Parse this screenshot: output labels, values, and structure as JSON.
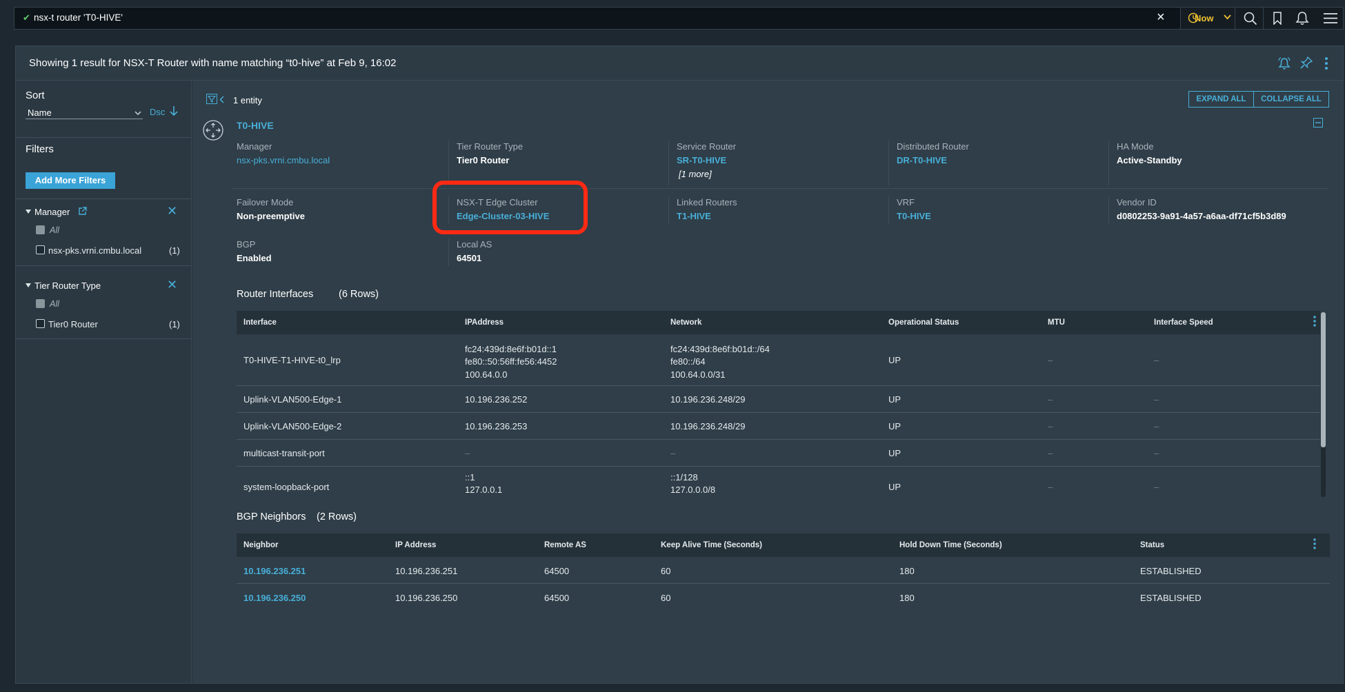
{
  "search": {
    "query": "nsx-t router 'T0-HIVE'",
    "time_label": "Now",
    "icons": [
      "check-icon",
      "close-icon",
      "clock-icon",
      "chevron-down-icon",
      "search-icon",
      "bookmark-icon",
      "bell-icon",
      "menu-icon"
    ]
  },
  "header": {
    "result_text": "Showing 1 result for NSX-T Router with name matching “t0-hive” at Feb 9, 16:02"
  },
  "sidebar": {
    "sort_title": "Sort",
    "sort_value": "Name",
    "sort_dir": "Dsc",
    "filters_title": "Filters",
    "add_filters_label": "Add More Filters",
    "groups": [
      {
        "title": "Manager",
        "all_label": "All",
        "items": [
          {
            "label": "nsx-pks.vrni.cmbu.local",
            "count": "(1)"
          }
        ]
      },
      {
        "title": "Tier Router Type",
        "all_label": "All",
        "items": [
          {
            "label": "Tier0 Router",
            "count": "(1)"
          }
        ]
      }
    ]
  },
  "content": {
    "entity_count": "1 entity",
    "expand_all": "EXPAND ALL",
    "collapse_all": "COLLAPSE ALL",
    "entity_name": "T0-HIVE",
    "properties": {
      "manager": {
        "label": "Manager",
        "value": "nsx-pks.vrni.cmbu.local"
      },
      "tier_router_type": {
        "label": "Tier Router Type",
        "value": "Tier0 Router"
      },
      "service_router": {
        "label": "Service Router",
        "value": "SR-T0-HIVE",
        "more": "[1 more]"
      },
      "distributed_router": {
        "label": "Distributed Router",
        "value": "DR-T0-HIVE"
      },
      "ha_mode": {
        "label": "HA Mode",
        "value": "Active-Standby"
      },
      "failover_mode": {
        "label": "Failover Mode",
        "value": "Non-preemptive"
      },
      "edge_cluster": {
        "label": "NSX-T Edge Cluster",
        "value": "Edge-Cluster-03-HIVE"
      },
      "linked_routers": {
        "label": "Linked Routers",
        "value": "T1-HIVE"
      },
      "vrf": {
        "label": "VRF",
        "value": "T0-HIVE"
      },
      "vendor_id": {
        "label": "Vendor ID",
        "value": "d0802253-9a91-4a57-a6aa-df71cf5b3d89"
      },
      "bgp": {
        "label": "BGP",
        "value": "Enabled"
      },
      "local_as": {
        "label": "Local AS",
        "value": "64501"
      }
    },
    "router_interfaces": {
      "title": "Router Interfaces",
      "count": "(6 Rows)",
      "columns": [
        "Interface",
        "IPAddress",
        "Network",
        "Operational Status",
        "MTU",
        "Interface Speed"
      ],
      "rows": [
        {
          "interface": "T0-HIVE-T1-HIVE-t0_lrp",
          "ip": [
            "fc24:439d:8e6f:b01d::1",
            "fe80::50:56ff:fe56:4452",
            "100.64.0.0"
          ],
          "network": [
            "fc24:439d:8e6f:b01d::/64",
            "fe80::/64",
            "100.64.0.0/31"
          ],
          "status": "UP",
          "mtu": "–",
          "speed": "–"
        },
        {
          "interface": "Uplink-VLAN500-Edge-1",
          "ip": [
            "10.196.236.252"
          ],
          "network": [
            "10.196.236.248/29"
          ],
          "status": "UP",
          "mtu": "–",
          "speed": "–"
        },
        {
          "interface": "Uplink-VLAN500-Edge-2",
          "ip": [
            "10.196.236.253"
          ],
          "network": [
            "10.196.236.248/29"
          ],
          "status": "UP",
          "mtu": "–",
          "speed": "–"
        },
        {
          "interface": "multicast-transit-port",
          "ip": [
            "–"
          ],
          "network": [
            "–"
          ],
          "status": "UP",
          "mtu": "–",
          "speed": "–"
        },
        {
          "interface": "system-loopback-port",
          "ip": [
            "::1",
            "127.0.0.1"
          ],
          "network": [
            "::1/128",
            "127.0.0.0/8"
          ],
          "status": "UP",
          "mtu": "–",
          "speed": "–"
        }
      ]
    },
    "bgp_neighbors": {
      "title": "BGP Neighbors",
      "count": "(2 Rows)",
      "columns": [
        "Neighbor",
        "IP Address",
        "Remote AS",
        "Keep Alive Time (Seconds)",
        "Hold Down Time (Seconds)",
        "Status"
      ],
      "rows": [
        {
          "neighbor": "10.196.236.251",
          "ip": "10.196.236.251",
          "remote_as": "64500",
          "keep_alive": "60",
          "hold_down": "180",
          "status": "ESTABLISHED"
        },
        {
          "neighbor": "10.196.236.250",
          "ip": "10.196.236.250",
          "remote_as": "64500",
          "keep_alive": "60",
          "hold_down": "180",
          "status": "ESTABLISHED"
        }
      ]
    }
  },
  "colors": {
    "accent": "#49afd9",
    "highlight": "#ff2a14",
    "now_accent": "#f1c232"
  }
}
